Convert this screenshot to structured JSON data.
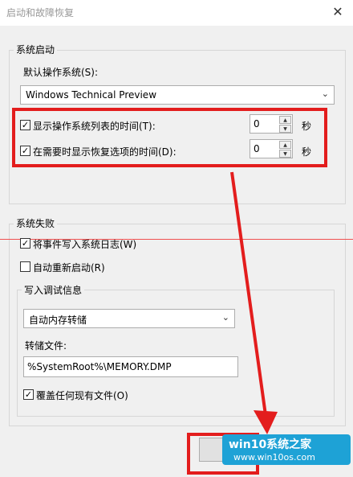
{
  "window": {
    "title": "启动和故障恢复",
    "close_glyph": "✕"
  },
  "system_startup": {
    "legend": "系统启动",
    "default_os_label": "默认操作系统(S):",
    "default_os_value": "Windows Technical Preview",
    "show_list": {
      "checked": true,
      "label": "显示操作系统列表的时间(T):",
      "value": "0",
      "unit": "秒"
    },
    "show_recovery": {
      "checked": true,
      "label": "在需要时显示恢复选项的时间(D):",
      "value": "0",
      "unit": "秒"
    }
  },
  "system_failure": {
    "legend": "系统失败",
    "write_event": {
      "checked": true,
      "label": "将事件写入系统日志(W)"
    },
    "auto_restart": {
      "checked": false,
      "label": "自动重新启动(R)"
    },
    "debug": {
      "legend": "写入调试信息",
      "type_value": "自动内存转储",
      "dump_file_label": "转储文件:",
      "dump_file_value": "%SystemRoot%\\MEMORY.DMP",
      "overwrite": {
        "checked": true,
        "label": "覆盖任何现有文件(O)"
      }
    }
  },
  "watermark": {
    "line1": "win10系统之家",
    "line2": "www.win10os.com"
  },
  "colors": {
    "highlight_red": "#e31d1d",
    "watermark_blue": "#1ea2d6"
  }
}
